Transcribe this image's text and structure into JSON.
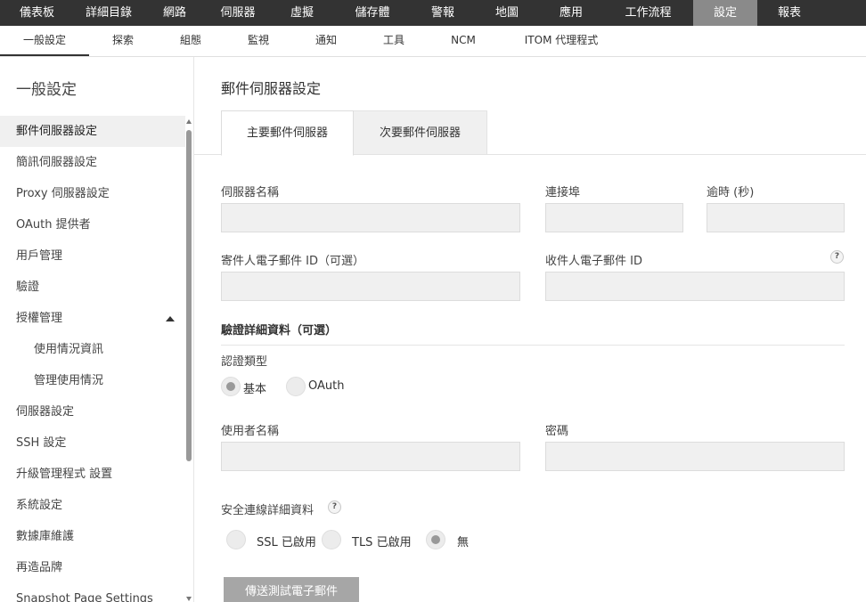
{
  "top_nav": {
    "items": [
      "儀表板",
      "詳細目錄",
      "網路",
      "伺服器",
      "虛擬",
      "儲存體",
      "警報",
      "地圖",
      "應用",
      "工作流程",
      "設定",
      "報表"
    ],
    "active": "設定"
  },
  "sub_nav": {
    "items": [
      "一般設定",
      "探索",
      "組態",
      "監視",
      "通知",
      "工具",
      "NCM",
      "ITOM 代理程式"
    ],
    "active": "一般設定"
  },
  "sidebar": {
    "title": "一般設定",
    "items": [
      {
        "label": "郵件伺服器設定"
      },
      {
        "label": "簡訊伺服器設定"
      },
      {
        "label": "Proxy 伺服器設定"
      },
      {
        "label": "OAuth 提供者"
      },
      {
        "label": "用戶管理"
      },
      {
        "label": "驗證"
      },
      {
        "label": "授權管理"
      },
      {
        "label": "使用情況資訊"
      },
      {
        "label": "管理使用情況"
      },
      {
        "label": "伺服器設定"
      },
      {
        "label": "SSH 設定"
      },
      {
        "label": "升級管理程式 設置"
      },
      {
        "label": "系統設定"
      },
      {
        "label": "數據庫維護"
      },
      {
        "label": "再造品牌"
      },
      {
        "label": "Snapshot Page Settings"
      }
    ]
  },
  "main": {
    "title": "郵件伺服器設定",
    "tabs": [
      "主要郵件伺服器",
      "次要郵件伺服器"
    ],
    "fields": {
      "server_name": {
        "label": "伺服器名稱",
        "value": ""
      },
      "port": {
        "label": "連接埠",
        "value": ""
      },
      "timeout": {
        "label": "逾時 (秒)",
        "value": ""
      },
      "from_email": {
        "label": "寄件人電子郵件 ID（可選）",
        "value": ""
      },
      "to_email": {
        "label": "收件人電子郵件 ID",
        "value": ""
      },
      "username": {
        "label": "使用者名稱",
        "value": ""
      },
      "password": {
        "label": "密碼",
        "value": ""
      }
    },
    "help_glyph": "?",
    "auth_section": "驗證詳細資料（可選）",
    "auth_type_label": "認證類型",
    "auth_options": [
      {
        "label": "基本",
        "selected": true
      },
      {
        "label": "OAuth",
        "selected": false
      }
    ],
    "secure_label": "安全連線詳細資料",
    "secure_options": [
      {
        "label": "SSL 已啟用",
        "selected": false
      },
      {
        "label": "TLS 已啟用",
        "selected": false
      },
      {
        "label": "無",
        "selected": true
      }
    ],
    "test_button": "傳送測試電子郵件"
  }
}
